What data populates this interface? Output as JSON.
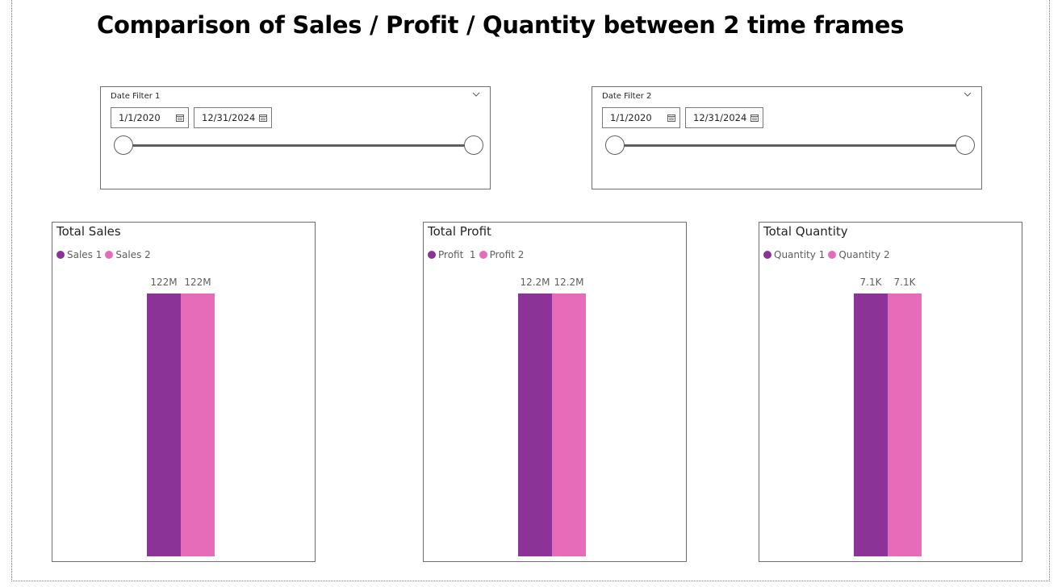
{
  "page": {
    "title": "Comparison of Sales / Profit / Quantity between 2 time frames"
  },
  "colors": {
    "series1": "#8b3396",
    "series2": "#e66bb8",
    "border": "#6f6f6f"
  },
  "slicers": [
    {
      "title": "Date Filter 1",
      "start": "1/1/2020",
      "end": "12/31/2024",
      "icon": "chevron-down-icon",
      "range_fraction": [
        0,
        1
      ]
    },
    {
      "title": "Date Filter 2",
      "start": "1/1/2020",
      "end": "12/31/2024",
      "icon": "chevron-down-icon",
      "range_fraction": [
        0,
        1
      ]
    }
  ],
  "chart_data": [
    {
      "type": "bar",
      "title": "Total Sales",
      "categories": [
        ""
      ],
      "series": [
        {
          "name": "Sales 1",
          "values": [
            122000000
          ],
          "label": "122M"
        },
        {
          "name": "Sales 2",
          "values": [
            122000000
          ],
          "label": "122M"
        }
      ],
      "ylim": [
        0,
        122000000
      ],
      "grid": false,
      "legend": "top-left"
    },
    {
      "type": "bar",
      "title": "Total Profit",
      "categories": [
        ""
      ],
      "series": [
        {
          "name": "Profit  1",
          "values": [
            12200000
          ],
          "label": "12.2M"
        },
        {
          "name": "Profit 2",
          "values": [
            12200000
          ],
          "label": "12.2M"
        }
      ],
      "ylim": [
        0,
        12200000
      ],
      "grid": false,
      "legend": "top-left"
    },
    {
      "type": "bar",
      "title": "Total Quantity",
      "categories": [
        ""
      ],
      "series": [
        {
          "name": "Quantity 1",
          "values": [
            7100
          ],
          "label": "7.1K"
        },
        {
          "name": "Quantity 2",
          "values": [
            7100
          ],
          "label": "7.1K"
        }
      ],
      "ylim": [
        0,
        7100
      ],
      "grid": false,
      "legend": "top-left"
    }
  ]
}
